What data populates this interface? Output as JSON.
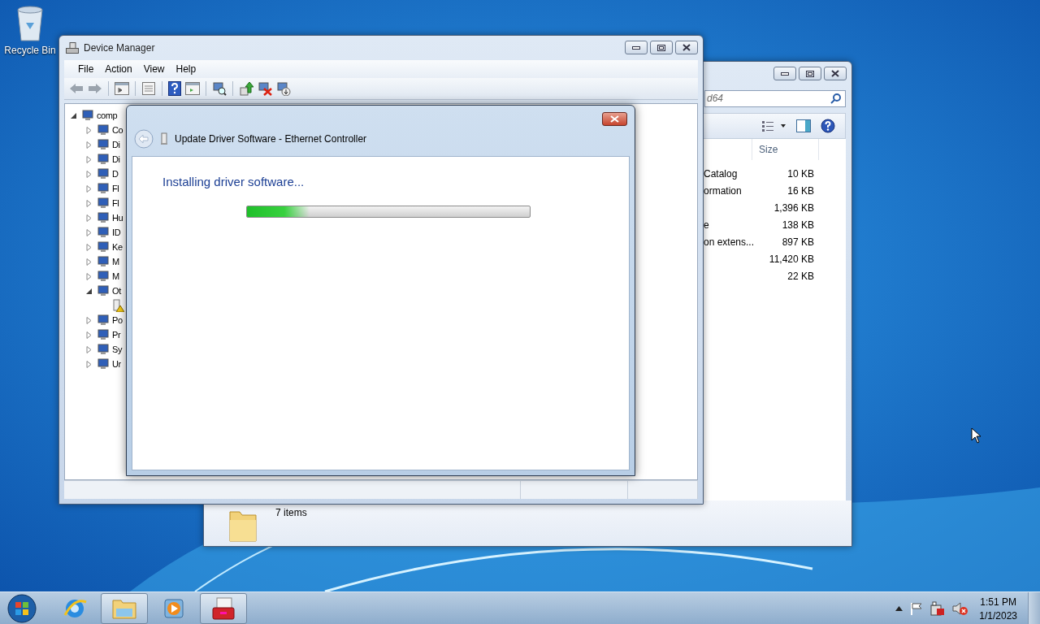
{
  "desktop": {
    "icons": [
      {
        "label": "Recycle Bin"
      }
    ]
  },
  "explorer": {
    "search": {
      "value": "d64"
    },
    "columns": [
      {
        "label": "Size"
      }
    ],
    "rows": [
      {
        "name": "Catalog",
        "size": "10 KB"
      },
      {
        "name": "ormation",
        "size": "16 KB"
      },
      {
        "size": "1,396 KB"
      },
      {
        "name": "e",
        "size": "138 KB"
      },
      {
        "name": "on extens...",
        "size": "897 KB"
      },
      {
        "size": "11,420 KB"
      },
      {
        "size": "22 KB"
      }
    ],
    "status": "7 items"
  },
  "device_manager": {
    "title": "Device Manager",
    "menu": [
      "File",
      "Action",
      "View",
      "Help"
    ],
    "tree": {
      "label": "comp",
      "expanded": true,
      "children": [
        {
          "label": "Co",
          "expanded": false
        },
        {
          "label": "Di",
          "expanded": false
        },
        {
          "label": "Di",
          "expanded": false
        },
        {
          "label": "D",
          "expanded": false
        },
        {
          "label": "Fl",
          "expanded": false
        },
        {
          "label": "Fl",
          "expanded": false
        },
        {
          "label": "Hu",
          "expanded": false
        },
        {
          "label": "ID",
          "expanded": false
        },
        {
          "label": "Ke",
          "expanded": false
        },
        {
          "label": "M",
          "expanded": false
        },
        {
          "label": "M",
          "expanded": false
        },
        {
          "label": "Ot",
          "expanded": true,
          "children": [
            {
              "warning": true
            }
          ]
        },
        {
          "label": "Po",
          "expanded": false
        },
        {
          "label": "Pr",
          "expanded": false
        },
        {
          "label": "Sy",
          "expanded": false
        },
        {
          "label": "Ur",
          "expanded": false
        }
      ]
    }
  },
  "dialog": {
    "title": "Update Driver Software - Ethernet Controller",
    "heading": "Installing driver software...",
    "progress": {
      "level": 0.22
    }
  },
  "taskbar": {
    "buttons": [
      {
        "kind": "browser",
        "running": false
      },
      {
        "kind": "folder",
        "running": true
      },
      {
        "kind": "media",
        "running": false
      },
      {
        "kind": "toolbox",
        "running": true
      }
    ]
  },
  "tray": {
    "time": "1:51 PM",
    "date": "1/1/2023"
  }
}
